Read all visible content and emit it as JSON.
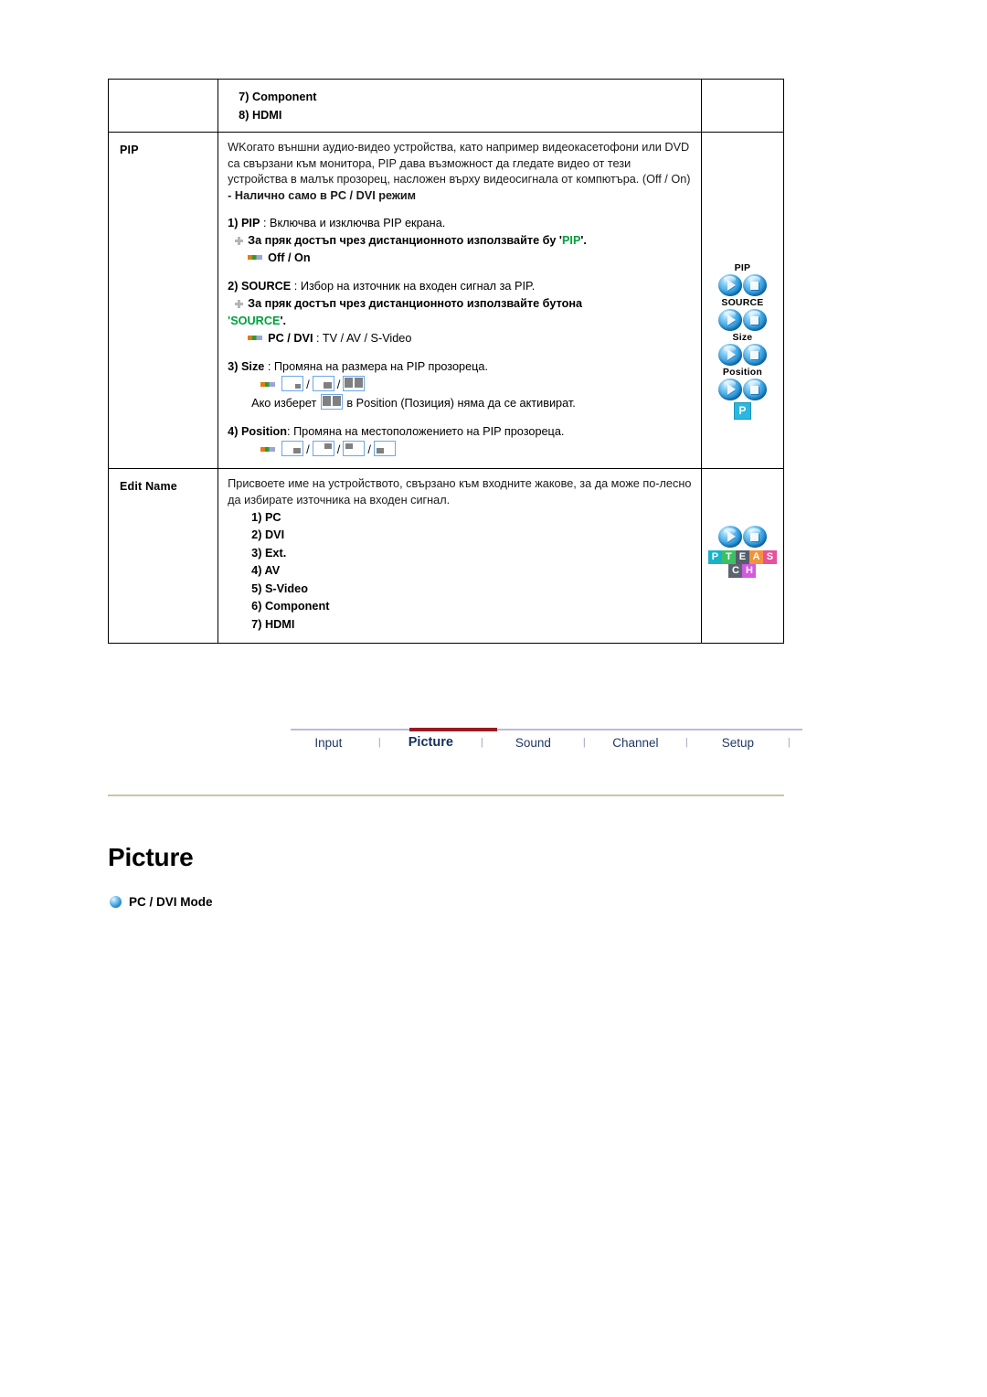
{
  "table": {
    "top_row": {
      "items": [
        "7) Component",
        "8) HDMI"
      ]
    },
    "pip_row": {
      "label": "PIP",
      "intro": "WKогато външни аудио-видео устройства, като например видеокасетофони или DVD са свързани към монитора, PIP дава възможност да гледате видео от тези устройства в малък прозорец, насложен върху видеосигнала от компютъра. (Off / On)",
      "note": "- Налично само в PC / DVI режим",
      "item1_num": "1) PIP",
      "item1_text": " : Включва и изключва PIP екрана.",
      "item1_tip_pre": "За пряк достъп чрез дистанционното използвайте бу '",
      "item1_tip_key": "PIP",
      "item1_tip_post": "'.",
      "item1_values": "Off / On",
      "item2_num": "2) SOURCE",
      "item2_text": " : Избор на източник на входен сигнал за PIP.",
      "item2_tip_pre": "За пряк достъп чрез дистанционното използвайте бутона",
      "item2_tip_key": "SOURCE",
      "item2_tip_quote_open": "'",
      "item2_tip_post": "'.",
      "item2_values_b": "PC / DVI",
      "item2_values_r": " : TV / AV / S-Video",
      "item3_num": "3) Size",
      "item3_text": " : Промяна на размера на PIP прозореца.",
      "item3_note_pre": "Ако изберет",
      "item3_note_post": "в Position (Позиция) няма да се активират.",
      "item4_num": "4) Position",
      "item4_text": ": Промяна на местоположението на PIP прозореца."
    },
    "editname_row": {
      "label": "Edit Name",
      "intro": "Присвоете име на устройството, свързано към входните жакове, за да може по-лесно да избирате източника на входен сигнал.",
      "items": [
        "1) PC",
        "2) DVI",
        "3) Ext.",
        "4) AV",
        "5) S-Video",
        "6) Component",
        "7) HDMI"
      ]
    }
  },
  "remote": {
    "captions": [
      "PIP",
      "SOURCE",
      "Size",
      "Position"
    ],
    "p_badge": "P"
  },
  "editname_art": {
    "letters_row1": [
      {
        "ch": "P",
        "color": "#19b3c9"
      },
      {
        "ch": "T",
        "color": "#3fbf63"
      },
      {
        "ch": "E",
        "color": "#555f6b"
      },
      {
        "ch": "A",
        "color": "#f2933c"
      },
      {
        "ch": "S",
        "color": "#e8519a"
      }
    ],
    "letters_row2": [
      {
        "ch": "C",
        "color": "#5c6470"
      },
      {
        "ch": "H",
        "color": "#d459e0"
      }
    ]
  },
  "nav": {
    "tabs": [
      {
        "label": "Input",
        "active": false
      },
      {
        "label": "Picture",
        "active": true
      },
      {
        "label": "Sound",
        "active": false
      },
      {
        "label": "Channel",
        "active": false
      },
      {
        "label": "Setup",
        "active": false
      }
    ],
    "separator": "|"
  },
  "section": {
    "title": "Picture",
    "subheading": "PC / DVI Mode"
  },
  "colors": {
    "accent_green": "#00a03c",
    "nav_text": "#1f3864",
    "nav_active_underline": "#9c1822",
    "gold_rule": "#c9c6a4"
  }
}
